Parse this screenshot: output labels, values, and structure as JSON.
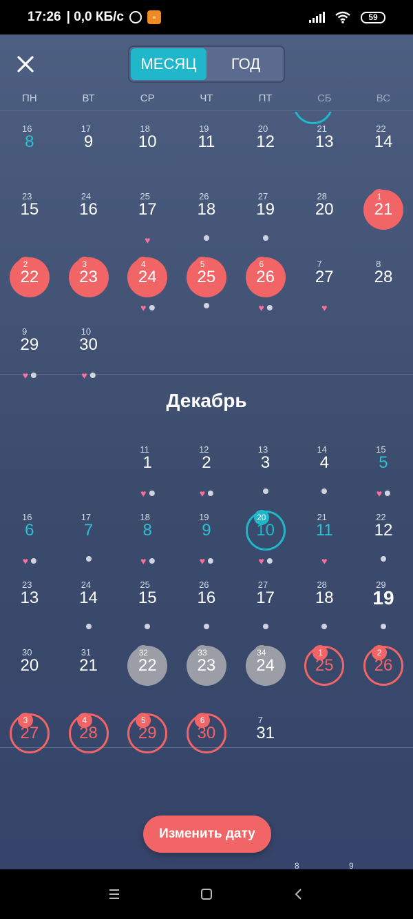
{
  "status": {
    "time": "17:26",
    "speed": "| 0,0 КБ/с",
    "battery": "59"
  },
  "header": {
    "close_icon": "close-icon",
    "tabs": [
      {
        "label": "МЕСЯЦ",
        "active": true
      },
      {
        "label": "ГОД",
        "active": false
      }
    ],
    "weekdays": [
      "ПН",
      "ВТ",
      "СР",
      "ЧТ",
      "ПТ",
      "СБ",
      "ВС"
    ]
  },
  "november": {
    "rows": [
      [
        {
          "cd": "16",
          "day": "8",
          "style": "teal"
        },
        {
          "cd": "17",
          "day": "9"
        },
        {
          "cd": "18",
          "day": "10"
        },
        {
          "cd": "19",
          "day": "11"
        },
        {
          "cd": "20",
          "day": "12"
        },
        {
          "cd": "21",
          "day": "13"
        },
        {
          "cd": "22",
          "day": "14"
        }
      ],
      [
        {
          "cd": "23",
          "day": "15"
        },
        {
          "cd": "24",
          "day": "16"
        },
        {
          "cd": "25",
          "day": "17",
          "marks": [
            "heart"
          ]
        },
        {
          "cd": "26",
          "day": "18",
          "marks": [
            "dot"
          ]
        },
        {
          "cd": "27",
          "day": "19",
          "marks": [
            "dot"
          ]
        },
        {
          "cd": "28",
          "day": "20"
        },
        {
          "cd": "1",
          "day": "21",
          "style": "red",
          "badge": "red"
        }
      ],
      [
        {
          "cd": "2",
          "day": "22",
          "style": "red",
          "badge": "red"
        },
        {
          "cd": "3",
          "day": "23",
          "style": "red",
          "badge": "red"
        },
        {
          "cd": "4",
          "day": "24",
          "style": "red",
          "badge": "red",
          "marks": [
            "heart",
            "dot"
          ]
        },
        {
          "cd": "5",
          "day": "25",
          "style": "red",
          "badge": "red",
          "marks": [
            "dot"
          ]
        },
        {
          "cd": "6",
          "day": "26",
          "style": "red",
          "badge": "red",
          "marks": [
            "heart",
            "dot"
          ]
        },
        {
          "cd": "7",
          "day": "27",
          "marks": [
            "heart"
          ]
        },
        {
          "cd": "8",
          "day": "28"
        }
      ],
      [
        {
          "cd": "9",
          "day": "29",
          "marks": [
            "heart",
            "dot"
          ]
        },
        {
          "cd": "10",
          "day": "30",
          "marks": [
            "heart",
            "dot"
          ]
        },
        null,
        null,
        null,
        null,
        null
      ]
    ]
  },
  "december": {
    "title": "Декабрь",
    "rows": [
      [
        null,
        null,
        {
          "cd": "11",
          "day": "1",
          "marks": [
            "heart",
            "dot"
          ]
        },
        {
          "cd": "12",
          "day": "2",
          "marks": [
            "heart",
            "dot"
          ]
        },
        {
          "cd": "13",
          "day": "3",
          "marks": [
            "dot"
          ]
        },
        {
          "cd": "14",
          "day": "4",
          "marks": [
            "dot"
          ]
        },
        {
          "cd": "15",
          "day": "5",
          "style": "teal",
          "marks": [
            "heart",
            "dot"
          ]
        }
      ],
      [
        {
          "cd": "16",
          "day": "6",
          "style": "teal",
          "marks": [
            "heart",
            "dot"
          ]
        },
        {
          "cd": "17",
          "day": "7",
          "style": "teal",
          "marks": [
            "dot"
          ]
        },
        {
          "cd": "18",
          "day": "8",
          "style": "teal",
          "marks": [
            "heart",
            "dot"
          ]
        },
        {
          "cd": "19",
          "day": "9",
          "style": "teal",
          "marks": [
            "heart",
            "dot"
          ]
        },
        {
          "cd": "20",
          "day": "10",
          "style": "teal-outline",
          "badge": "teal",
          "marks": [
            "heart",
            "dot"
          ]
        },
        {
          "cd": "21",
          "day": "11",
          "style": "teal",
          "marks": [
            "heart"
          ]
        },
        {
          "cd": "22",
          "day": "12",
          "marks": [
            "dot"
          ]
        }
      ],
      [
        {
          "cd": "23",
          "day": "13"
        },
        {
          "cd": "24",
          "day": "14",
          "marks": [
            "dot"
          ]
        },
        {
          "cd": "25",
          "day": "15",
          "marks": [
            "dot"
          ]
        },
        {
          "cd": "26",
          "day": "16",
          "marks": [
            "dot"
          ]
        },
        {
          "cd": "27",
          "day": "17",
          "marks": [
            "dot"
          ]
        },
        {
          "cd": "28",
          "day": "18",
          "marks": [
            "dot"
          ]
        },
        {
          "cd": "29",
          "day": "19",
          "style": "bold",
          "marks": [
            "dot"
          ]
        }
      ],
      [
        {
          "cd": "30",
          "day": "20"
        },
        {
          "cd": "31",
          "day": "21"
        },
        {
          "cd": "32",
          "day": "22",
          "style": "grey",
          "badge": "grey"
        },
        {
          "cd": "33",
          "day": "23",
          "style": "grey",
          "badge": "grey"
        },
        {
          "cd": "34",
          "day": "24",
          "style": "grey",
          "badge": "grey"
        },
        {
          "cd": "1",
          "day": "25",
          "style": "red-outline",
          "badge": "red"
        },
        {
          "cd": "2",
          "day": "26",
          "style": "red-outline",
          "badge": "red"
        }
      ],
      [
        {
          "cd": "3",
          "day": "27",
          "style": "red-outline",
          "badge": "red"
        },
        {
          "cd": "4",
          "day": "28",
          "style": "red-outline",
          "badge": "red"
        },
        {
          "cd": "5",
          "day": "29",
          "style": "red-outline",
          "badge": "red"
        },
        {
          "cd": "6",
          "day": "30",
          "style": "red-outline",
          "badge": "red"
        },
        {
          "cd": "7",
          "day": "31"
        },
        null,
        null
      ]
    ]
  },
  "change_date_button": "Изменить дату",
  "peek": [
    "8",
    "9"
  ],
  "colors": {
    "accent": "#1fb7c9",
    "period": "#f26566",
    "grey": "#9b9ea7",
    "heart": "#ff6f9b"
  }
}
